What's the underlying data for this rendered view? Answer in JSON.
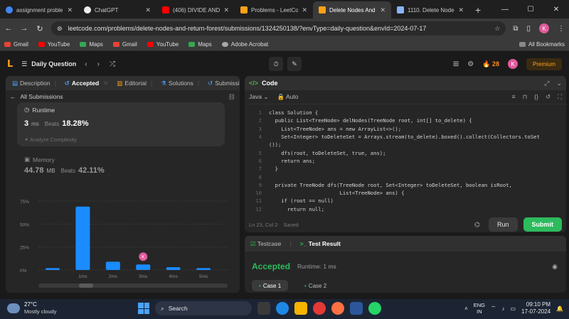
{
  "browser": {
    "tabs": [
      {
        "title": "assignment proble",
        "icon": "google-icon",
        "color": "#4285f4"
      },
      {
        "title": "ChatGPT",
        "icon": "chatgpt-icon",
        "color": "#ffffff"
      },
      {
        "title": "(406) DIVIDE AND",
        "icon": "youtube-icon",
        "color": "#ff0000"
      },
      {
        "title": "Problems - LeetCo",
        "icon": "leetcode-icon",
        "color": "#ffa116"
      },
      {
        "title": "Delete Nodes And",
        "icon": "leetcode-icon",
        "color": "#ffa116",
        "active": true
      },
      {
        "title": "1110. Delete Node",
        "icon": "leetcode-tab-icon",
        "color": "#8ab4f8"
      }
    ],
    "url": "leetcode.com/problems/delete-nodes-and-return-forest/submissions/1324250138/?envType=daily-question&envId=2024-07-17",
    "profile_initial": "K",
    "bookmarks": [
      {
        "label": "Gmail",
        "color": "#ea4335"
      },
      {
        "label": "YouTube",
        "color": "#ff0000"
      },
      {
        "label": "Maps",
        "color": "#34a853"
      },
      {
        "label": "Gmail",
        "color": "#ea4335"
      },
      {
        "label": "YouTube",
        "color": "#ff0000"
      },
      {
        "label": "Maps",
        "color": "#34a853"
      },
      {
        "label": "Adobe Acrobat",
        "color": "#cccccc"
      }
    ],
    "all_bookmarks": "All Bookmarks"
  },
  "lc_top": {
    "title": "Daily Question",
    "streak": "28",
    "avatar": "K",
    "premium": "Premium"
  },
  "left_panel": {
    "tabs": [
      "Description",
      "Accepted",
      "Editorial",
      "Solutions",
      "Submissions"
    ],
    "back_label": "All Submissions",
    "runtime": {
      "label": "Runtime",
      "value": "3",
      "unit": "ms",
      "beats_label": "Beats",
      "beats_pct": "18.28%",
      "analyze": "Analyze Complexity"
    },
    "memory": {
      "label": "Memory",
      "value": "44.78",
      "unit": "MB",
      "beats_label": "Beats",
      "beats_pct": "42.11%"
    }
  },
  "chart_data": {
    "type": "bar",
    "y_ticks": [
      "75%",
      "50%",
      "25%",
      "0%"
    ],
    "x_tick_labels": [
      "1ms",
      "2ms",
      "3ms",
      "4ms",
      "5ms"
    ],
    "bars": [
      {
        "x": 0,
        "value": 2
      },
      {
        "x": 1,
        "value": 69
      },
      {
        "x": 2,
        "value": 9
      },
      {
        "x": 3,
        "value": 6
      },
      {
        "x": 4,
        "value": 3
      },
      {
        "x": 5,
        "value": 2
      }
    ],
    "ylim": [
      0,
      75
    ],
    "highlight_bar_x": 3,
    "marker_label": "K",
    "bar_color": "#1a8cff"
  },
  "code_panel": {
    "title": "Code",
    "language": "Java",
    "mode": "Auto",
    "lines": [
      "class Solution {",
      "  public List<TreeNode> delNodes(TreeNode root, int[] to_delete) {",
      "    List<TreeNode> ans = new ArrayList<>();",
      "    Set<Integer> toDeleteSet = Arrays.stream(to_delete).boxed().collect(Collectors.toSet",
      "());",
      "    dfs(root, toDeleteSet, true, ans);",
      "    return ans;",
      "  }",
      "",
      "  private TreeNode dfs(TreeNode root, Set<Integer> toDeleteSet, boolean isRoot,",
      "                       List<TreeNode> ans) {",
      "    if (root == null)",
      "      return null;"
    ],
    "line_numbers": [
      "1",
      "2",
      "3",
      "4",
      "",
      "5",
      "6",
      "7",
      "8",
      "9",
      "10",
      "11",
      "12"
    ],
    "cursor": "Ln 23, Col 2",
    "saved": "Saved",
    "run": "Run",
    "submit": "Submit"
  },
  "result_panel": {
    "tab1": "Testcase",
    "tab2": "Test Result",
    "status": "Accepted",
    "runtime": "Runtime: 1 ms",
    "cases": [
      "Case 1",
      "Case 2"
    ]
  },
  "taskbar": {
    "temp": "27°C",
    "condition": "Mostly cloudy",
    "search": "Search",
    "lang1": "ENG",
    "lang2": "IN",
    "time": "09:10 PM",
    "date": "17-07-2024"
  }
}
